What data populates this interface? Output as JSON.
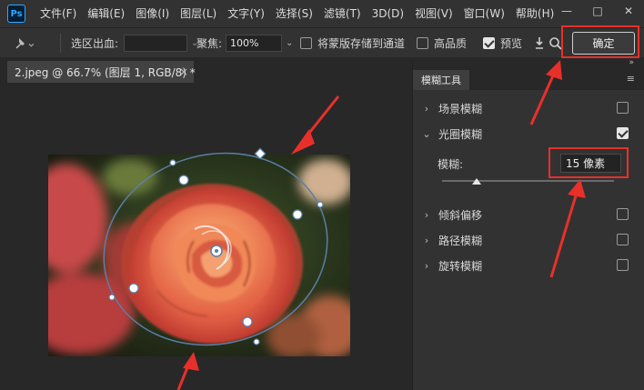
{
  "app": {
    "logo_text": "Ps"
  },
  "menu": [
    "文件(F)",
    "编辑(E)",
    "图像(I)",
    "图层(L)",
    "文字(Y)",
    "选择(S)",
    "滤镜(T)",
    "3D(D)",
    "视图(V)",
    "窗口(W)",
    "帮助(H)"
  ],
  "window_controls": {
    "minimize": "—",
    "maximize": "□",
    "close": "✕"
  },
  "options": {
    "selection_bleed_label": "选区出血:",
    "selection_bleed_value": "",
    "focus_label": "聚焦:",
    "focus_value": "100%",
    "save_mask_label": "将蒙版存储到通道",
    "save_mask_checked": false,
    "high_quality_label": "高品质",
    "high_quality_checked": false,
    "preview_label": "预览",
    "preview_checked": true,
    "ok_label": "确定"
  },
  "document": {
    "tab_title": "2.jpeg @ 66.7% (图层 1, RGB/8) *",
    "close_glyph": "×"
  },
  "panel": {
    "tab_label": "模糊工具",
    "collapse_glyph": "»",
    "menu_glyph": "≡",
    "items": [
      {
        "label": "场景模糊",
        "expanded": false,
        "checked": false
      },
      {
        "label": "光圈模糊",
        "expanded": true,
        "checked": true
      },
      {
        "label": "倾斜偏移",
        "expanded": false,
        "checked": false
      },
      {
        "label": "路径模糊",
        "expanded": false,
        "checked": false
      },
      {
        "label": "旋转模糊",
        "expanded": false,
        "checked": false
      }
    ],
    "blur_label": "模糊:",
    "blur_value": "15 像素",
    "blur_slider_fraction": 0.2
  },
  "colors": {
    "annotation": "#e8302a",
    "ui_bg": "#323232",
    "canvas_bg": "#282828",
    "ps_blue": "#31a8ff",
    "handle": "#5a7fa8"
  },
  "icons": {
    "pin": "pin-icon",
    "dropdown": "chevron-down-icon",
    "search": "search-icon",
    "arrow": "download-arrow-icon"
  }
}
